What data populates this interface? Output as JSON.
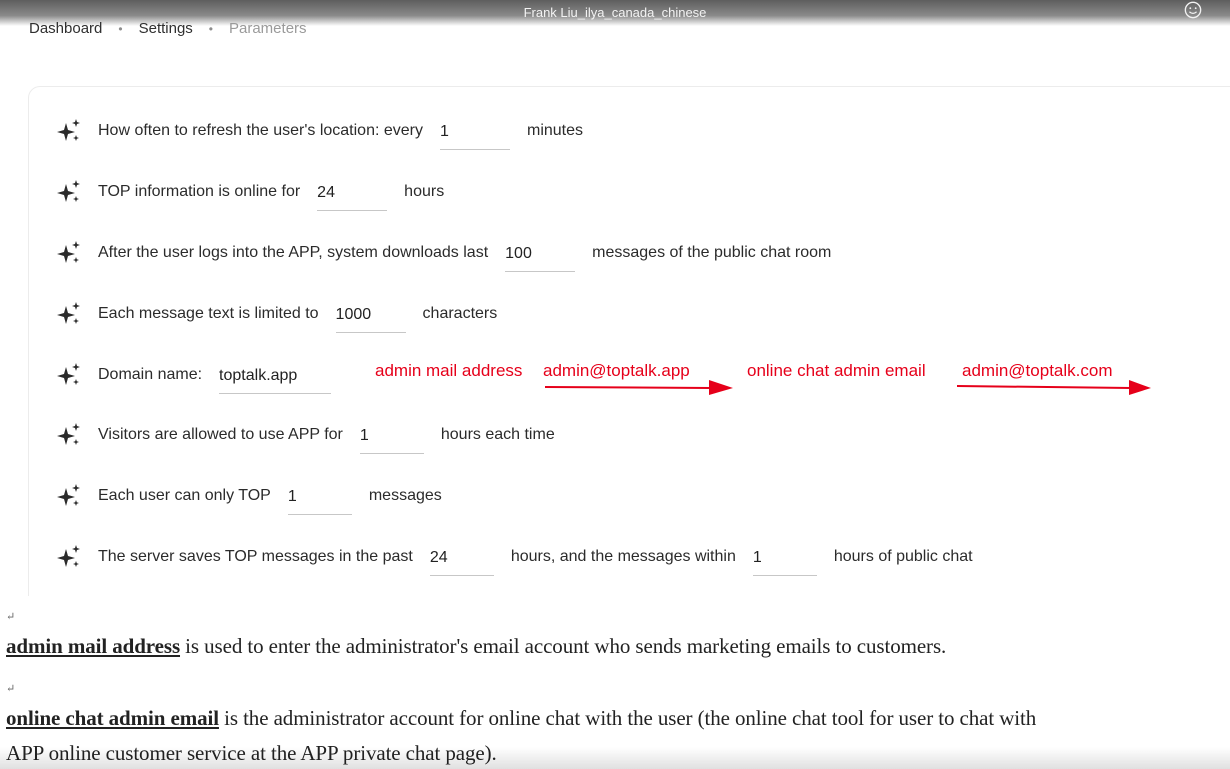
{
  "window": {
    "title": "Frank Liu_ilya_canada_chinese",
    "icon": "smiley-icon"
  },
  "breadcrumb": {
    "items": [
      "Dashboard",
      "Settings",
      "Parameters"
    ],
    "separator": "•"
  },
  "parameters": {
    "refresh": {
      "label": "How often to refresh the user's location: every",
      "value": "1",
      "suffix": "minutes"
    },
    "top_online": {
      "label": "TOP information is online for",
      "value": "24",
      "suffix": "hours"
    },
    "download": {
      "label": "After the user logs into the APP, system downloads last",
      "value": "100",
      "suffix": "messages of the public chat room"
    },
    "msg_limit": {
      "label": "Each message text is limited to",
      "value": "1000",
      "suffix": "characters"
    },
    "domain": {
      "label": "Domain name:",
      "value": "toptalk.app"
    },
    "visitors": {
      "label": "Visitors are allowed to use APP for",
      "value": "1",
      "suffix": "hours each time"
    },
    "user_top": {
      "label": "Each user can only TOP",
      "value": "1",
      "suffix": "messages"
    },
    "server": {
      "label": "The server saves TOP messages in the past",
      "value": "24",
      "middle": "hours, and the messages within",
      "value2": "1",
      "suffix": "hours of public chat"
    }
  },
  "annotations": {
    "admin_mail_label": "admin mail address",
    "admin_mail_value": "admin@toptalk.app",
    "chat_admin_label": "online chat admin email",
    "chat_admin_value": "admin@toptalk.com",
    "color": "#e6001a"
  },
  "doc": {
    "para_mark": "↵",
    "para1_term": "admin mail address",
    "para1_text": " is used to enter the administrator's email account who sends marketing emails to customers.",
    "para2_term": "online chat admin email",
    "para2_text": " is the administrator account for online chat with the user (the online chat tool for user to chat with",
    "para2_line2": "APP online customer service at the APP private chat page)."
  }
}
